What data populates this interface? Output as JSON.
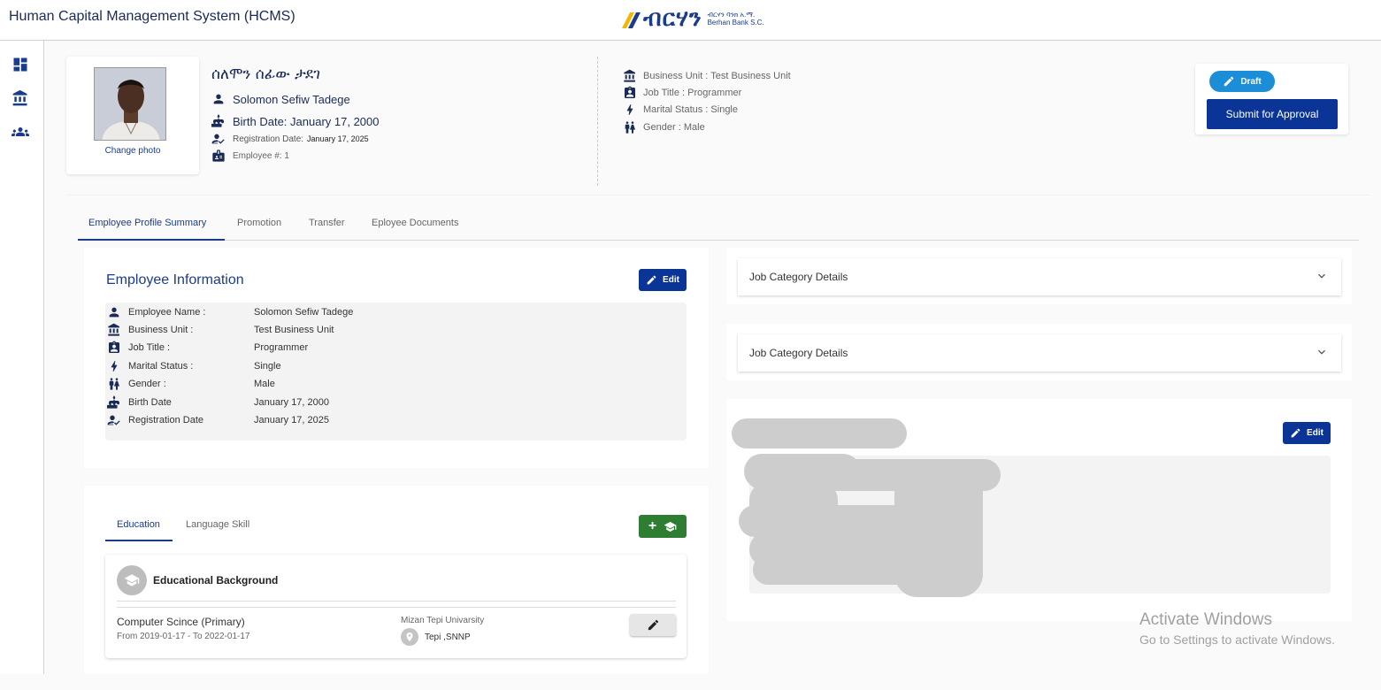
{
  "app": {
    "title": "Human Capital Management System (HCMS)"
  },
  "brand": {
    "logo_text": "ብርሃን",
    "subtitle_amharic": "ብርሃን ባንክ አ.ማ.",
    "subtitle_english": "Berhan Bank S.C.",
    "color_primary": "#1b3c8c",
    "color_accent": "#f2b705"
  },
  "sidebar": {
    "items": [
      {
        "icon": "dashboard-icon"
      },
      {
        "icon": "bank-icon"
      },
      {
        "icon": "people-icon"
      }
    ]
  },
  "profile": {
    "change_photo_label": "Change photo",
    "name_amharic": "ሰለሞን ሰፊው ታደገ",
    "full_name": "Solomon Sefiw Tadege",
    "birth_date": "Birth Date: January 17, 2000",
    "registration_date": "Registration Date:",
    "registration_value": "January 17, 2025",
    "employee_no": "Employee #: 1",
    "business_unit": "Business Unit : Test Business Unit",
    "job_title": "Job Title : Programmer",
    "marital_status": "Marital Status : Single",
    "gender": "Gender : Male"
  },
  "status": {
    "draft_label": "Draft",
    "submit_label": "Submit for Approval",
    "draft_color": "#1c8ed8",
    "submit_color": "#0a3596"
  },
  "tabs": [
    {
      "label": "Employee Profile Summary",
      "active": true
    },
    {
      "label": "Promotion",
      "active": false
    },
    {
      "label": "Transfer",
      "active": false
    },
    {
      "label": "Eployee Documents",
      "active": false
    }
  ],
  "employee_info": {
    "title": "Employee Information",
    "edit_label": "Edit",
    "rows": [
      {
        "label": "Employee Name :",
        "value": "Solomon Sefiw Tadege"
      },
      {
        "label": "Business Unit :",
        "value": "Test Business Unit"
      },
      {
        "label": "Job Title :",
        "value": "Programmer"
      },
      {
        "label": "Marital Status :",
        "value": "Single"
      },
      {
        "label": "Gender :",
        "value": "Male"
      },
      {
        "label": "Birth Date",
        "value": "January 17, 2000"
      },
      {
        "label": "Registration Date",
        "value": "January 17, 2025"
      }
    ]
  },
  "education": {
    "tabs": [
      {
        "label": "Education",
        "active": true
      },
      {
        "label": "Language Skill",
        "active": false
      }
    ],
    "add_label": "+",
    "heading": "Educational Background",
    "entry": {
      "degree": "Computer Scince (Primary)",
      "dates": "From 2019-01-17 - To 2022-01-17",
      "school": "Mizan Tepi Univarsity",
      "location": "Tepi ,SNNP"
    }
  },
  "accordions": [
    {
      "title": "Job Category Details"
    },
    {
      "title": "Job Category Details"
    }
  ],
  "redacted_panel": {
    "edit_label": "Edit"
  },
  "watermark": {
    "line1": "Activate Windows",
    "line2": "Go to Settings to activate Windows."
  }
}
